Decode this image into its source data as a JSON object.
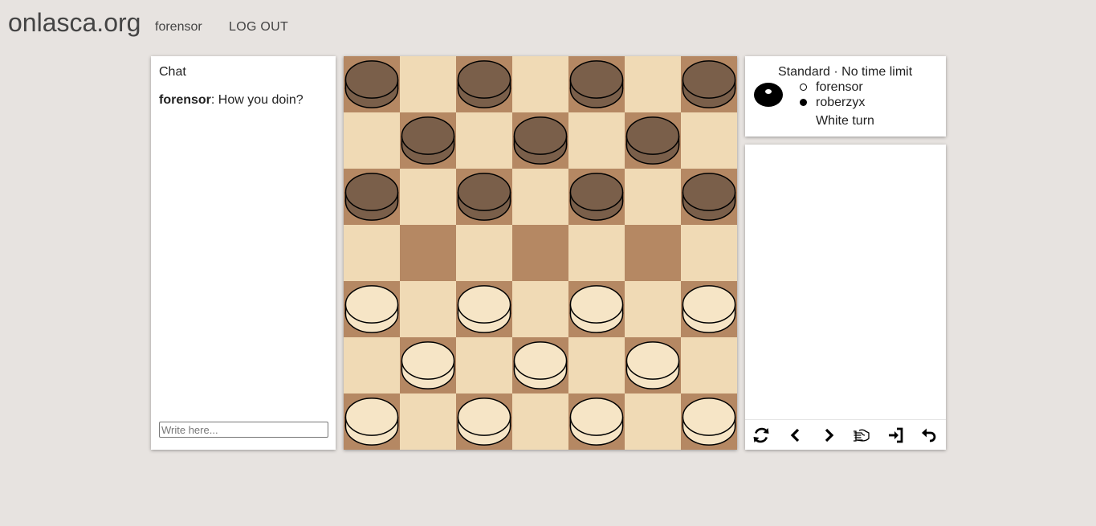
{
  "header": {
    "logo": "onlasca.org",
    "user": "forensor",
    "logout": "LOG OUT"
  },
  "chat": {
    "title": "Chat",
    "messages": [
      {
        "author": "forensor",
        "text": ": How you doin?"
      }
    ],
    "input_placeholder": "Write here..."
  },
  "game": {
    "title": "Standard · No time limit",
    "players": [
      {
        "name": "forensor",
        "color": "white"
      },
      {
        "name": "roberzyx",
        "color": "black"
      }
    ],
    "status": "White turn"
  },
  "board": {
    "size": 7,
    "colors": {
      "dark_square": "#b58863",
      "light_square": "#f0dab5",
      "dark_piece": "#7a5f4a",
      "light_piece": "#f6e5c6"
    },
    "pieces": [
      [
        "b",
        null,
        "b",
        null,
        "b",
        null,
        "b"
      ],
      [
        null,
        "b",
        null,
        "b",
        null,
        "b",
        null
      ],
      [
        "b",
        null,
        "b",
        null,
        "b",
        null,
        "b"
      ],
      [
        null,
        null,
        null,
        null,
        null,
        null,
        null
      ],
      [
        "w",
        null,
        "w",
        null,
        "w",
        null,
        "w"
      ],
      [
        null,
        "w",
        null,
        "w",
        null,
        "w",
        null
      ],
      [
        "w",
        null,
        "w",
        null,
        "w",
        null,
        "w"
      ]
    ]
  },
  "controls": [
    {
      "name": "flip-board-icon"
    },
    {
      "name": "previous-move-icon"
    },
    {
      "name": "next-move-icon"
    },
    {
      "name": "offer-draw-icon"
    },
    {
      "name": "resign-icon"
    },
    {
      "name": "undo-icon"
    }
  ]
}
